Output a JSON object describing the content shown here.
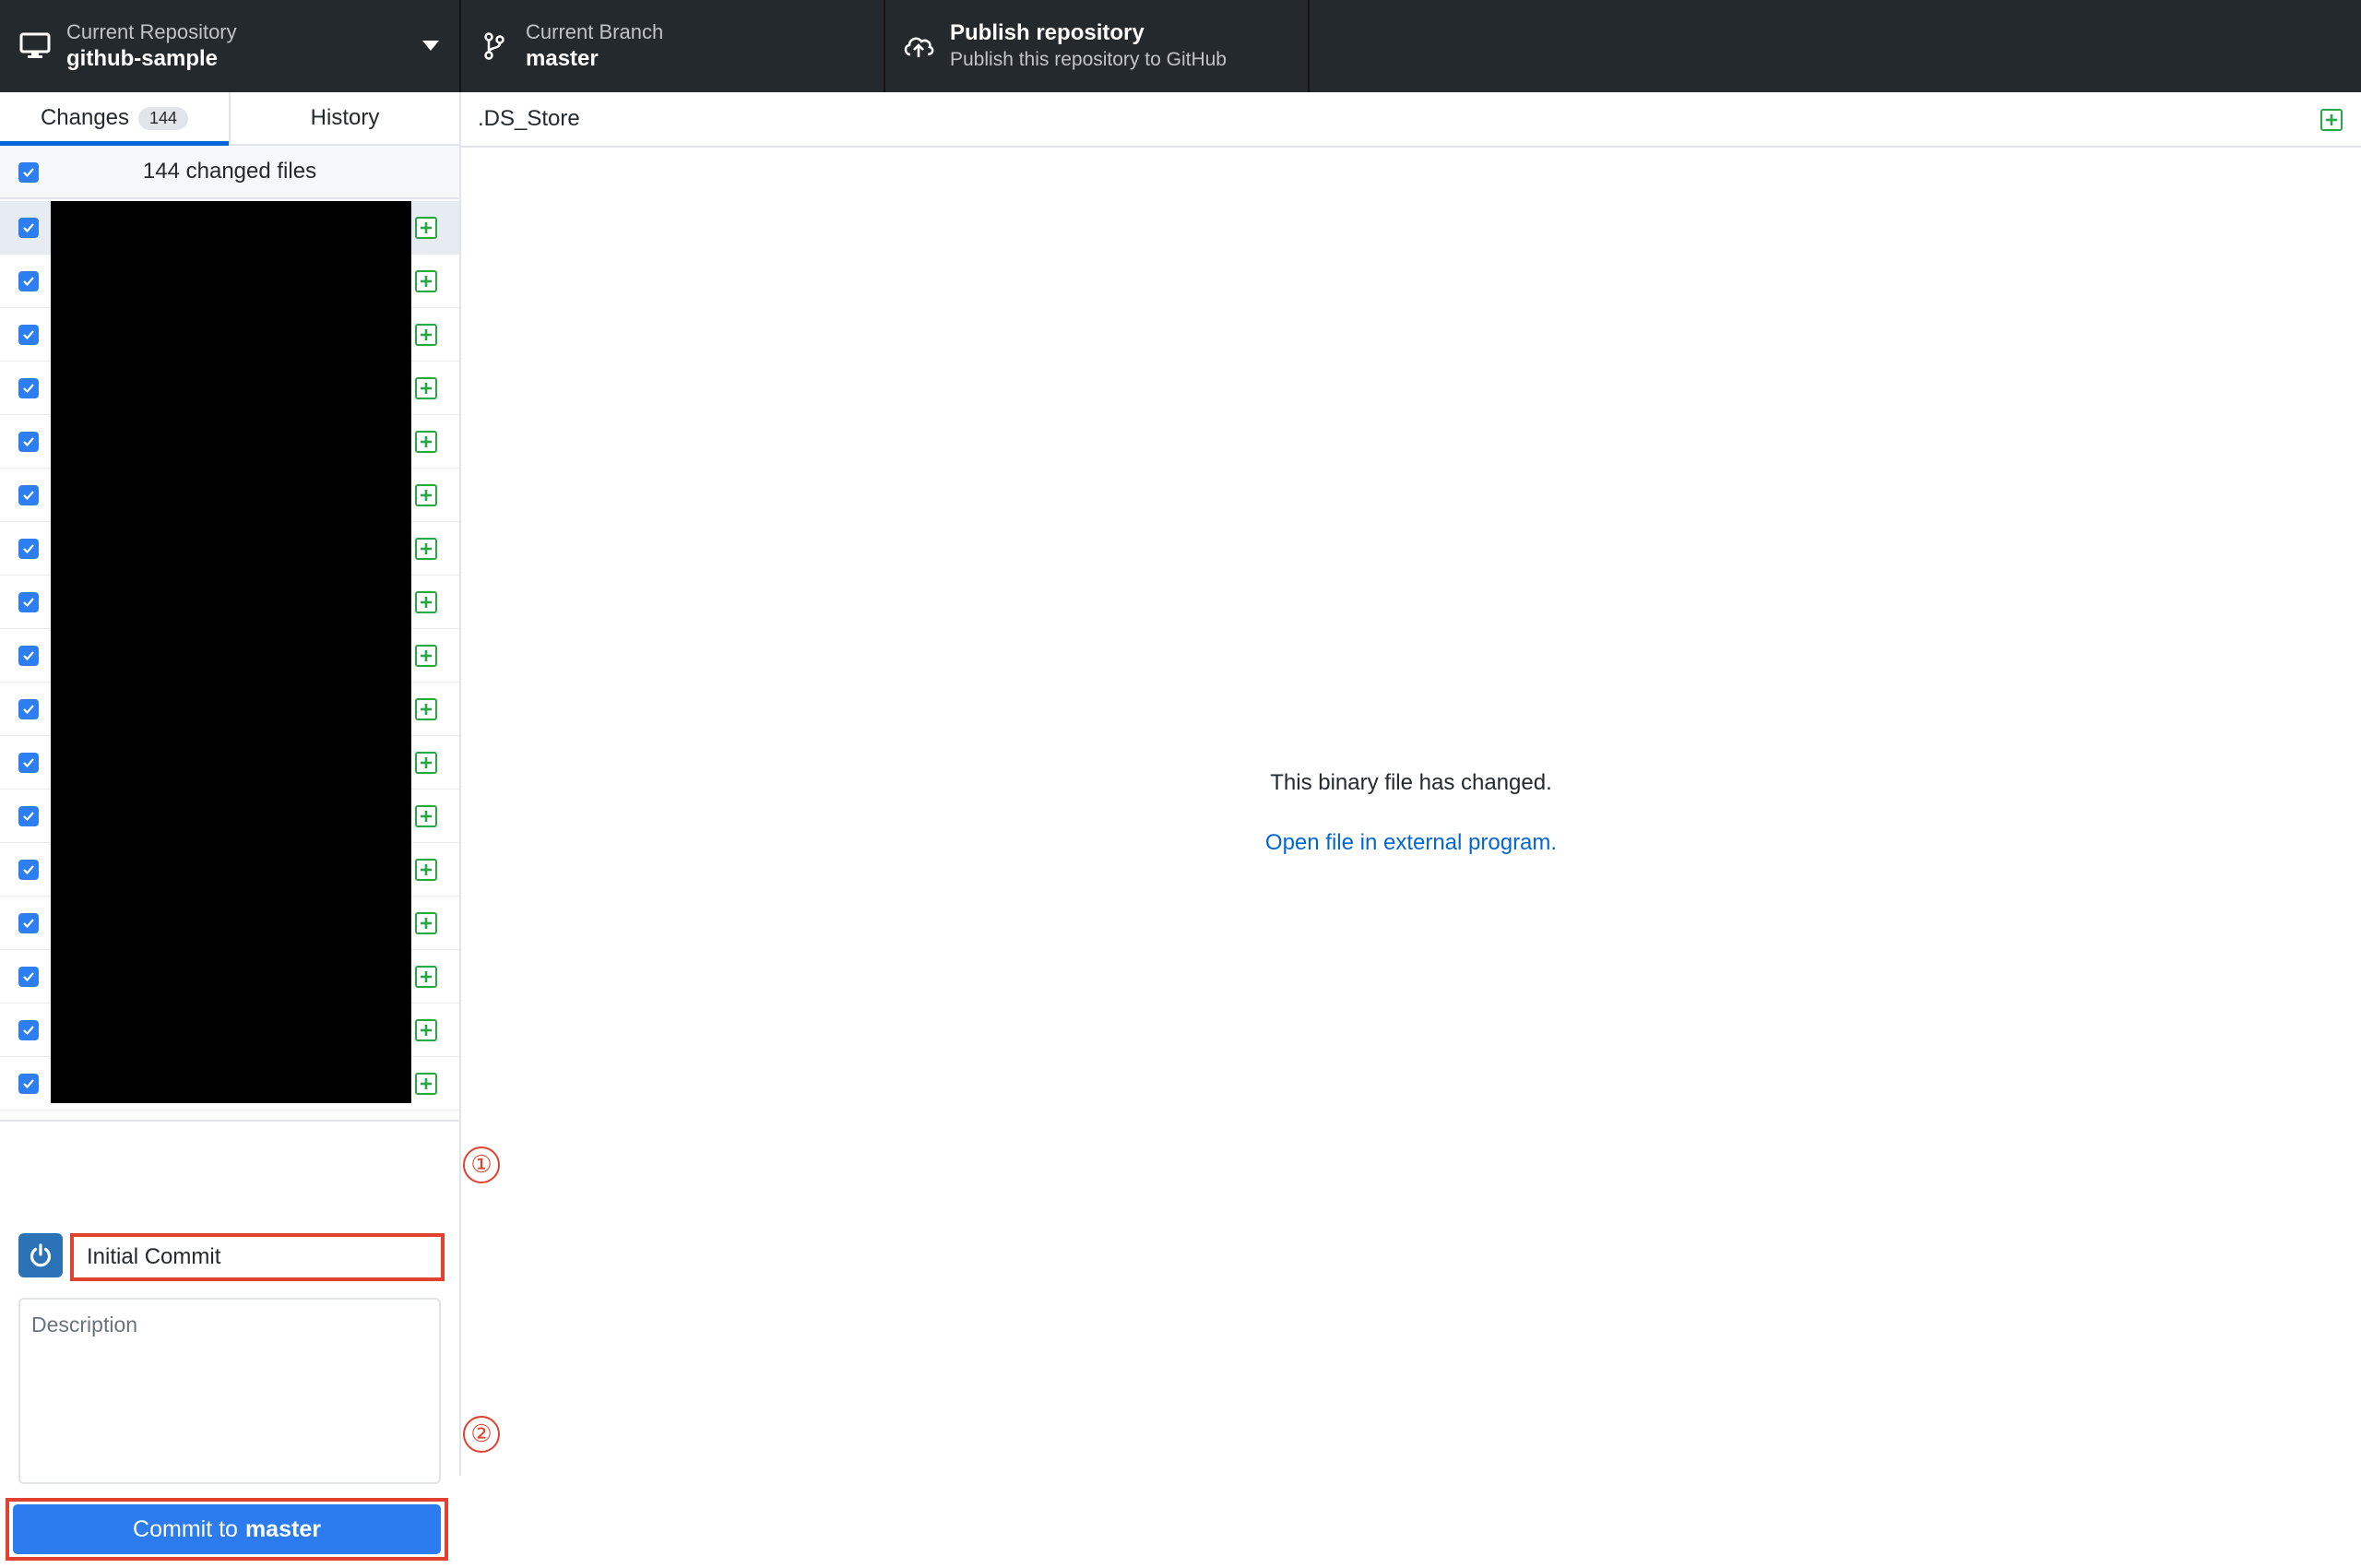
{
  "toolbar": {
    "repo_label": "Current Repository",
    "repo_name": "github-sample",
    "branch_label": "Current Branch",
    "branch_name": "master",
    "publish_title": "Publish repository",
    "publish_subtitle": "Publish this repository to GitHub"
  },
  "sidebar": {
    "tabs": [
      {
        "label": "Changes",
        "count": "144",
        "active": true
      },
      {
        "label": "History",
        "active": false
      }
    ],
    "changed_files_label": "144 changed files",
    "visible_file_rows": 17,
    "file_names_redacted": true
  },
  "commit": {
    "summary_value": "Initial Commit",
    "description_placeholder": "Description",
    "button_prefix": "Commit to",
    "button_branch": "master"
  },
  "annotations": {
    "marker_1": "①",
    "marker_2": "②"
  },
  "diff": {
    "file_name": ".DS_Store",
    "message": "This binary file has changed.",
    "link": "Open file in external program."
  },
  "colors": {
    "toolbar_bg": "#24292e",
    "accent_blue": "#0366d6",
    "checkbox_blue": "#2d7ef0",
    "added_green": "#28a745",
    "annotation_red": "#e0422f"
  }
}
